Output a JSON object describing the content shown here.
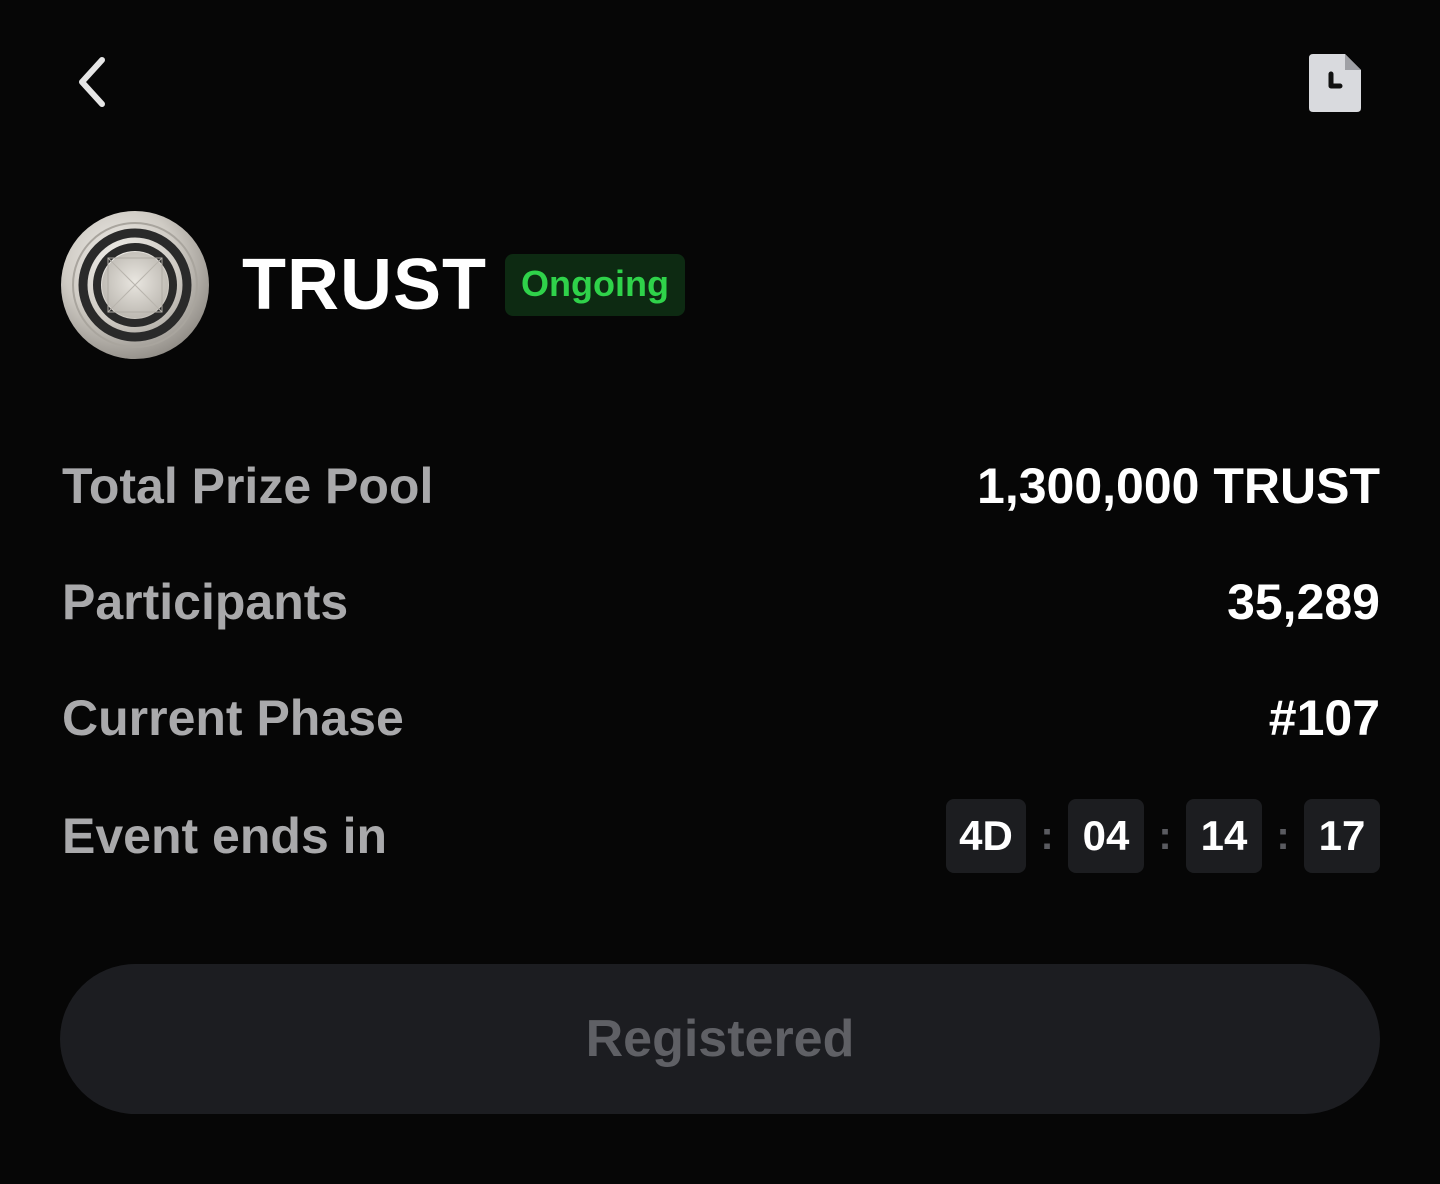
{
  "nav": {
    "back_icon": "chevron-left-icon",
    "history_icon": "clock-document-icon"
  },
  "token": {
    "logo_icon": "trust-coin-logo",
    "name": "TRUST",
    "status": "Ongoing",
    "status_color": "#2fd24a"
  },
  "info": {
    "prize_pool": {
      "label": "Total Prize Pool",
      "value": "1,300,000 TRUST"
    },
    "participants": {
      "label": "Participants",
      "value": "35,289"
    },
    "phase": {
      "label": "Current Phase",
      "value": "#107"
    },
    "ends": {
      "label": "Event ends in",
      "days": "4D",
      "hours": "04",
      "minutes": "14",
      "seconds": "17",
      "separator": ":"
    }
  },
  "action": {
    "button_label": "Registered"
  }
}
